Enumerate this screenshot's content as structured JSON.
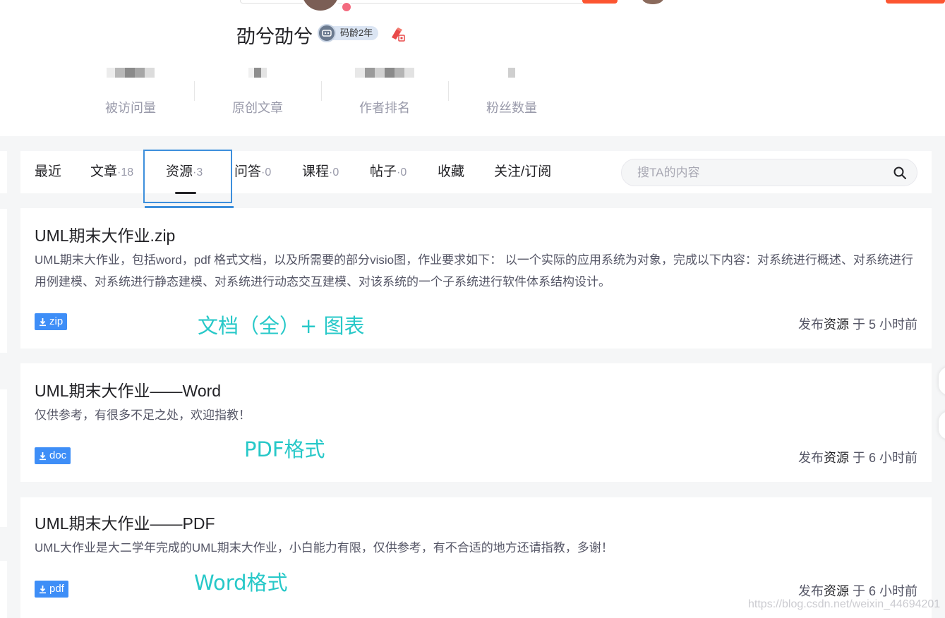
{
  "profile": {
    "username": "劭兮劭兮",
    "codeage_label": "码龄2年",
    "stats": [
      {
        "label": "被访问量"
      },
      {
        "label": "原创文章"
      },
      {
        "label": "作者排名"
      },
      {
        "label": "粉丝数量"
      }
    ]
  },
  "tabs": [
    {
      "label": "最近",
      "count": ""
    },
    {
      "label": "文章",
      "count": "·18"
    },
    {
      "label": "资源",
      "count": "·3",
      "active": true
    },
    {
      "label": "问答",
      "count": "·0"
    },
    {
      "label": "课程",
      "count": "·0"
    },
    {
      "label": "帖子",
      "count": "·0"
    },
    {
      "label": "收藏",
      "count": ""
    },
    {
      "label": "关注/订阅",
      "count": ""
    }
  ],
  "search": {
    "placeholder": "搜TA的内容"
  },
  "resources": [
    {
      "title": "UML期末大作业.zip",
      "desc": "UML期末大作业，包括word，pdf 格式文档，以及所需要的部分visio图，作业要求如下： 以一个实际的应用系统为对象，完成以下内容：对系统进行概述、对系统进行用例建模、对系统进行静态建模、对系统进行动态交互建模、对该系统的一个子系统进行软件体系结构设计。",
      "filetype": "zip",
      "time_prefix": "发布",
      "time_kind": "资源",
      "time_suffix": "于 5 小时前",
      "annotation": "文档（全）+ 图表"
    },
    {
      "title": "UML期末大作业——Word",
      "desc": "仅供参考，有很多不足之处，欢迎指教！",
      "filetype": "doc",
      "time_prefix": "发布",
      "time_kind": "资源",
      "time_suffix": "于 6 小时前",
      "annotation": "PDF格式"
    },
    {
      "title": "UML期末大作业——PDF",
      "desc": "UML大作业是大二学年完成的UML期末大作业，小白能力有限，仅供参考，有不合适的地方还请指教，多谢！",
      "filetype": "pdf",
      "time_prefix": "发布",
      "time_kind": "资源",
      "time_suffix": "于 6 小时前",
      "annotation": "Word格式"
    }
  ],
  "watermark": "https://blog.csdn.net/weixin_44694201",
  "colors": {
    "accent_red": "#fc5531",
    "filetype_blue": "#3e8ef7",
    "annotation_cyan": "#27c8c8",
    "highlight_box": "#3d8fdc"
  }
}
